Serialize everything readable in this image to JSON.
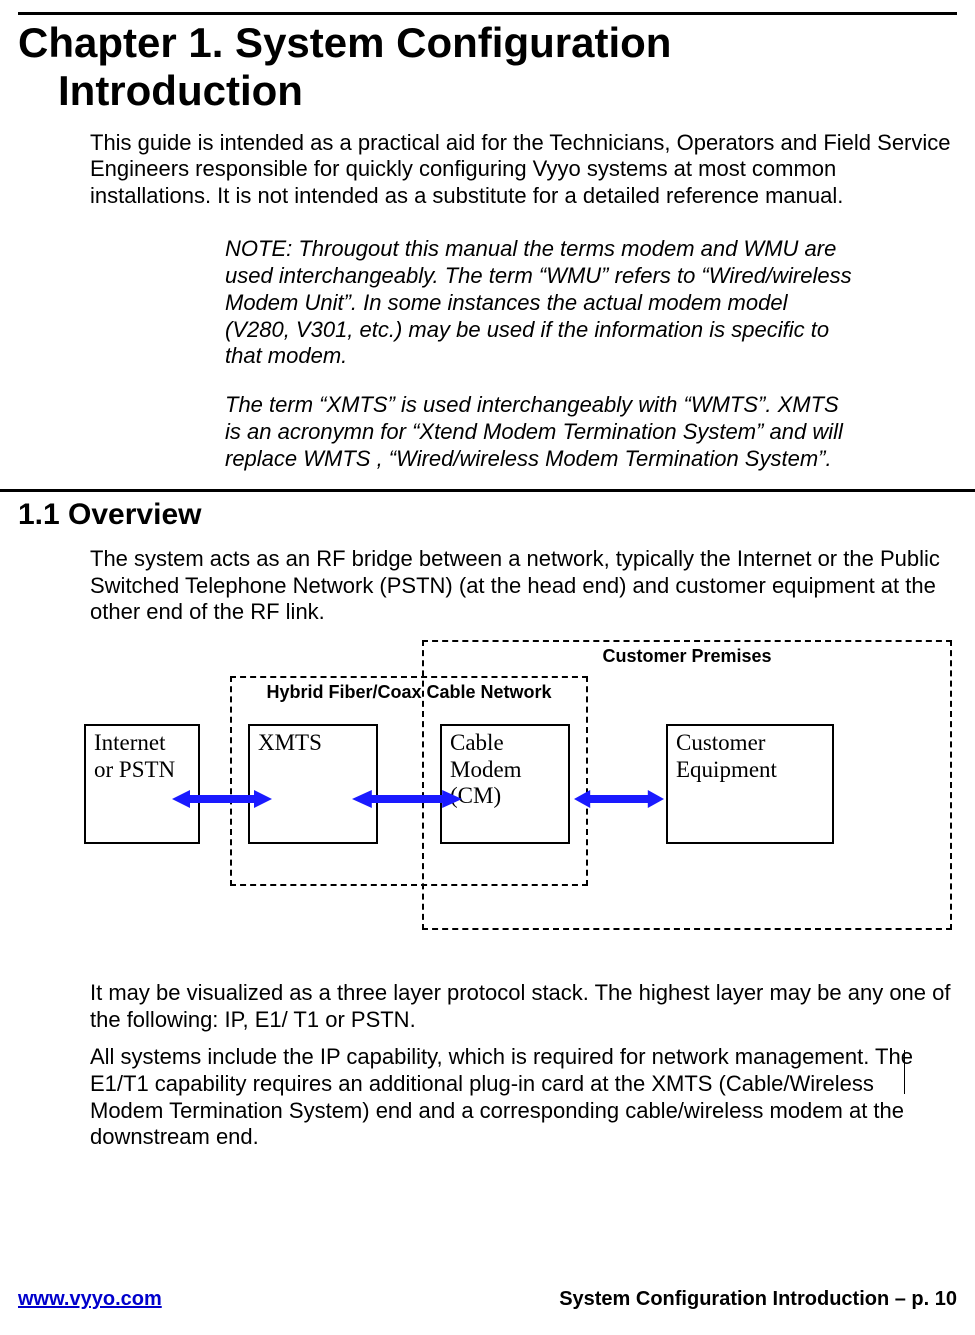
{
  "chapter": {
    "title_line1": "Chapter 1. System Configuration",
    "title_line2": "Introduction"
  },
  "intro_para": "This guide is intended as a practical aid for the Technicians, Operators and Field Service Engineers responsible for quickly configuring Vyyo systems at most common installations. It is not intended as a substitute for a detailed reference manual.",
  "note": {
    "p1": "NOTE:  Througout this manual the terms modem and WMU are used interchangeably.   The term “WMU” refers to “Wired/wireless Modem Unit”.  In some instances the actual modem model (V280, V301, etc.) may be used if the information is specific to that modem.",
    "p2": " The term “XMTS” is used interchangeably with “WMTS”.  XMTS is an acronymn for “Xtend Modem Termination System” and will replace WMTS , “Wired/wireless Modem Termination System”."
  },
  "section": {
    "heading": "1.1  Overview",
    "p1": "The system acts as an RF bridge between a network, typically the Internet or the Public Switched Telephone Network (PSTN) (at the head end) and customer equipment at the other end of the RF link.",
    "p2": "It may be visualized as a three layer protocol stack. The highest layer may be any one of the following: IP, E1/ T1 or PSTN.",
    "p3": "All systems include the IP capability, which is required for network management.  The E1/T1 capability requires an  additional plug-in card at the XMTS (Cable/Wireless Modem Termination System) end and a corresponding cable/wireless modem at the downstream end."
  },
  "diagram": {
    "customer_premises": "Customer Premises",
    "hfc_label": "Hybrid Fiber/Coax Cable Network",
    "box_internet": "Internet or PSTN",
    "box_xmts": "XMTS",
    "box_cm_l1": "Cable",
    "box_cm_l2": "Modem",
    "box_cm_l3": "(CM)",
    "box_cust_l1": "Customer",
    "box_cust_l2": "Equipment",
    "arrow_color": "#1a1aff"
  },
  "footer": {
    "url": "www.vyyo.com",
    "right": "System Configuration Introduction – p. 10"
  }
}
